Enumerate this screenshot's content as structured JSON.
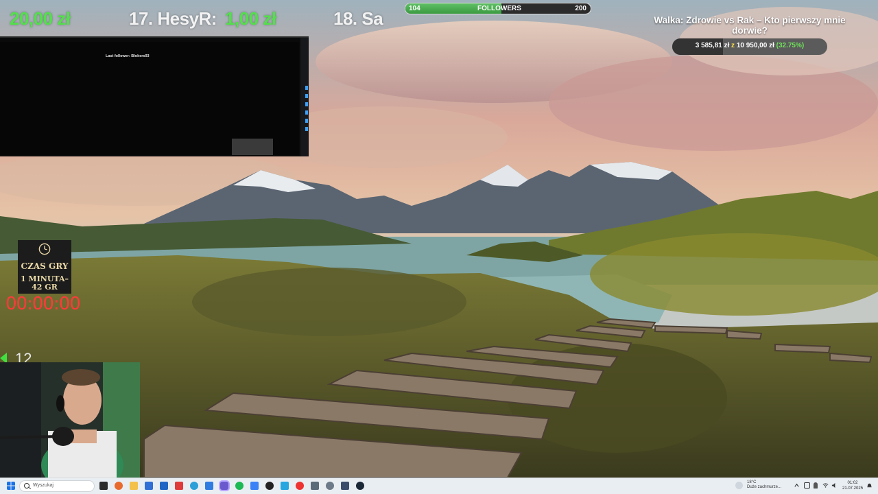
{
  "ticker": {
    "item_amount_left": "20,00 zł",
    "item_17_label": "17. HesyR:",
    "item_17_amount": "1,00 zł",
    "item_18_label": "18. Sa"
  },
  "followers": {
    "current": "104",
    "label": "FOLLOWERS",
    "goal": "200",
    "progress": 0.52
  },
  "goal": {
    "title": "Walka: Zdrowie vs Rak – Kto pierwszy mnie dorwie?",
    "raised": "3 585,81 zł",
    "sep": "z",
    "target": "10 950,00 zł",
    "percent": "(32.75%)",
    "progress": 0.3275
  },
  "panel": {
    "last_follower": "Last follower: Blokers93"
  },
  "game_time": {
    "title": "CZAS GRY",
    "line1": "1 MINUTA–",
    "line2": "42 GR",
    "timer": "00:00:00"
  },
  "viewers": {
    "count": "12"
  },
  "taskbar": {
    "search_placeholder": "Wyszukaj",
    "weather_temp": "18°C",
    "weather_desc": "Duże zachmurze...",
    "time": "01:02",
    "date": "21.07.2025"
  },
  "colors": {
    "accent_green": "#53e04b",
    "timer_red": "#ff3a3a",
    "goal_yellow": "#ffe14a"
  }
}
